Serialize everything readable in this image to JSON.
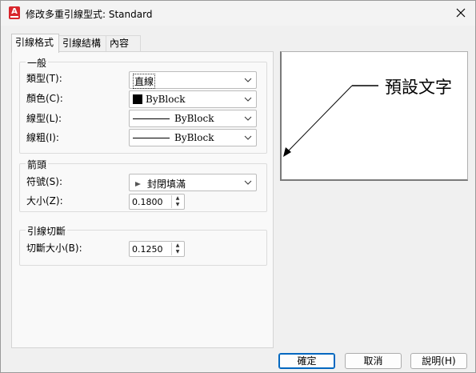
{
  "window": {
    "title": "修改多重引線型式: Standard"
  },
  "tabs": [
    {
      "label": "引線格式",
      "active": true
    },
    {
      "label": "引線結構",
      "active": false
    },
    {
      "label": "內容",
      "active": false
    }
  ],
  "general": {
    "legend": "一般",
    "type": {
      "label": "類型(T):",
      "value": "直線"
    },
    "color": {
      "label": "顏色(C):",
      "value": "ByBlock"
    },
    "linetype": {
      "label": "線型(L):",
      "value": "ByBlock"
    },
    "lineweight": {
      "label": "線粗(I):",
      "value": "ByBlock"
    }
  },
  "arrowhead": {
    "legend": "箭頭",
    "symbol": {
      "label": "符號(S):",
      "value": "封閉填滿"
    },
    "size": {
      "label": "大小(Z):",
      "value": "0.1800"
    }
  },
  "landing_break": {
    "legend": "引線切斷",
    "break_size": {
      "label": "切斷大小(B):",
      "value": "0.1250"
    }
  },
  "preview": {
    "text": "預設文字"
  },
  "buttons": {
    "ok": "確定",
    "cancel": "取消",
    "help": "說明(H)"
  }
}
